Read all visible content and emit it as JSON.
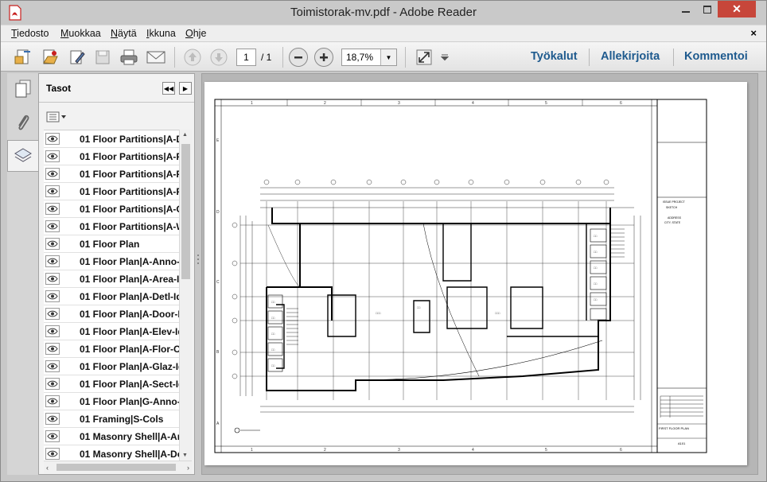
{
  "window": {
    "title": "Toimistorak-mv.pdf - Adobe Reader",
    "close_label": "✕"
  },
  "menu": {
    "items": [
      "Tiedosto",
      "Muokkaa",
      "Näytä",
      "Ikkuna",
      "Ohje"
    ],
    "close_label": "×"
  },
  "toolbar": {
    "page_current": "1",
    "page_total": "/ 1",
    "zoom": "18,7%",
    "links": [
      "Työkalut",
      "Allekirjoita",
      "Kommentoi"
    ]
  },
  "panel": {
    "title": "Tasot",
    "layers": [
      "01 Floor Partitions|A-D",
      "01 Floor Partitions|A-F",
      "01 Floor Partitions|A-F",
      "01 Floor Partitions|A-F",
      "01 Floor Partitions|A-G",
      "01 Floor Partitions|A-W",
      "01 Floor Plan",
      "01 Floor Plan|A-Anno-",
      "01 Floor Plan|A-Area-I",
      "01 Floor Plan|A-Detl-Id",
      "01 Floor Plan|A-Door-I",
      "01 Floor Plan|A-Elev-Id",
      "01 Floor Plan|A-Flor-O",
      "01 Floor Plan|A-Glaz-Id",
      "01 Floor Plan|A-Sect-Id",
      "01 Floor Plan|G-Anno-",
      "01 Framing|S-Cols",
      "01 Masonry Shell|A-An",
      "01 Masonry Shell|A-Do"
    ]
  },
  "drawing": {
    "grid_top": [
      "1",
      "2",
      "3",
      "4",
      "5",
      "6"
    ],
    "grid_side": [
      "E",
      "D",
      "C",
      "B",
      "A"
    ],
    "title_block": [
      "FIRST FLOOR PLAN",
      "A101"
    ]
  },
  "colors": {
    "link": "#1e5a8e",
    "close": "#c7463a",
    "pdf_red": "#c8201e"
  }
}
